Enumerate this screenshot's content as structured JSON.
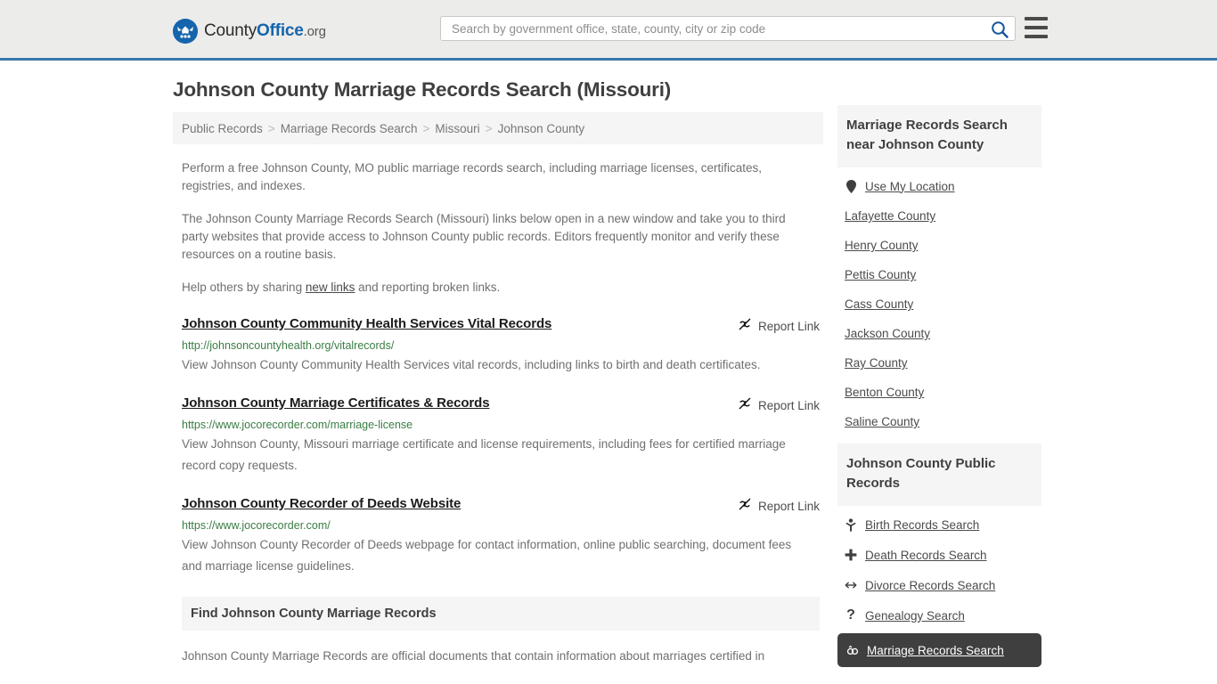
{
  "header": {
    "logo": {
      "part1": "County",
      "part2": "Office",
      "part3": ".org",
      "icon": "eagle-seal-icon"
    },
    "search": {
      "placeholder": "Search by government office, state, county, city or zip code",
      "value": ""
    },
    "search_icon": "search-icon",
    "menu_icon": "hamburger-menu-icon"
  },
  "main": {
    "title": "Johnson County Marriage Records Search (Missouri)",
    "breadcrumb": [
      "Public Records",
      "Marriage Records Search",
      "Missouri",
      "Johnson County"
    ],
    "breadcrumb_separator": ">",
    "intro_1": "Perform a free Johnson County, MO public marriage records search, including marriage licenses, certificates, registries, and indexes.",
    "intro_2": "The Johnson County Marriage Records Search (Missouri) links below open in a new window and take you to third party websites that provide access to Johnson County public records. Editors frequently monitor and verify these resources on a routine basis.",
    "help_prefix": "Help others by sharing ",
    "help_link": "new links",
    "help_suffix": " and reporting broken links.",
    "report_link_label": "Report Link",
    "report_link_icon": "broken-link-icon",
    "results": [
      {
        "title": "Johnson County Community Health Services Vital Records",
        "url": "http://johnsoncountyhealth.org/vitalrecords/",
        "description": "View Johnson County Community Health Services vital records, including links to birth and death certificates."
      },
      {
        "title": "Johnson County Marriage Certificates & Records",
        "url": "https://www.jocorecorder.com/marriage-license",
        "description": "View Johnson County, Missouri marriage certificate and license requirements, including fees for certified marriage record copy requests."
      },
      {
        "title": "Johnson County Recorder of Deeds Website",
        "url": "https://www.jocorecorder.com/",
        "description": "View Johnson County Recorder of Deeds webpage for contact information, online public searching, document fees and marriage license guidelines."
      }
    ],
    "find_section": {
      "heading": "Find Johnson County Marriage Records",
      "paragraph": "Johnson County Marriage Records are official documents that contain information about marriages certified in"
    }
  },
  "sidebar": {
    "nearby": {
      "heading": "Marriage Records Search near Johnson County",
      "items": [
        {
          "label": "Use My Location",
          "icon": "map-pin-icon"
        },
        {
          "label": "Lafayette County",
          "icon": ""
        },
        {
          "label": "Henry County",
          "icon": ""
        },
        {
          "label": "Pettis County",
          "icon": ""
        },
        {
          "label": "Cass County",
          "icon": ""
        },
        {
          "label": "Jackson County",
          "icon": ""
        },
        {
          "label": "Ray County",
          "icon": ""
        },
        {
          "label": "Benton County",
          "icon": ""
        },
        {
          "label": "Saline County",
          "icon": ""
        }
      ]
    },
    "public_records": {
      "heading": "Johnson County Public Records",
      "items": [
        {
          "label": "Birth Records Search",
          "icon": "baby-icon",
          "glyph": "Ɣ",
          "active": false
        },
        {
          "label": "Death Records Search",
          "icon": "cross-icon",
          "glyph": "✚",
          "active": false
        },
        {
          "label": "Divorce Records Search",
          "icon": "left-right-arrow-icon",
          "glyph": "↔",
          "active": false
        },
        {
          "label": "Genealogy Search",
          "icon": "question-mark-icon",
          "glyph": "?",
          "active": false
        },
        {
          "label": "Marriage Records Search",
          "icon": "rings-icon",
          "glyph": "⚭",
          "active": true
        }
      ]
    }
  },
  "colors": {
    "header_bg": "#ececeb",
    "header_border": "#3a76a8",
    "brand_blue": "#1565ad",
    "url_green": "#3a7d44",
    "panel_gray": "#f5f5f5",
    "active_dark": "#3f3f3f"
  }
}
